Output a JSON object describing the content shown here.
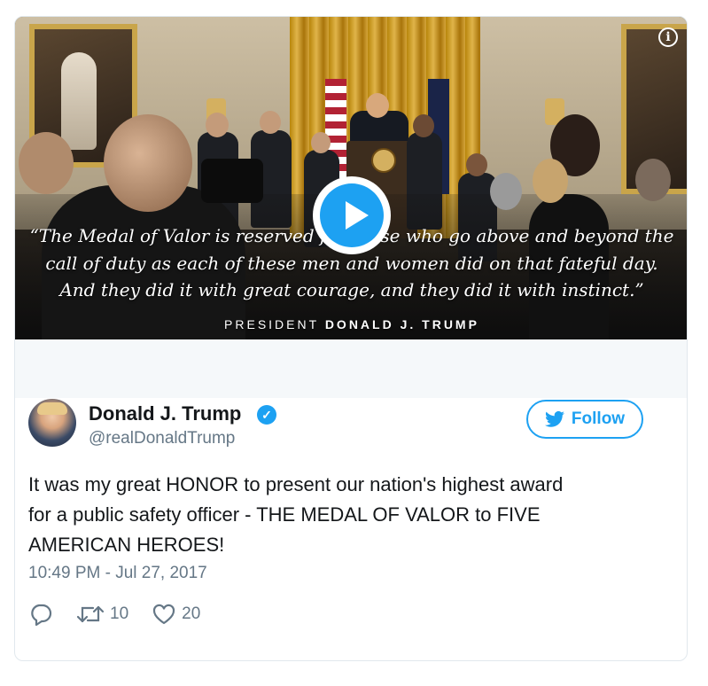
{
  "media": {
    "quote_lines": [
      "“The Medal of Valor is reserved for those who go above and beyond the",
      "call of duty as each of these men and women did on that fateful day.",
      "And they did it with great courage, and they did it with instinct.”"
    ],
    "attribution_prefix": "PRESIDENT",
    "attribution_name": "DONALD J. TRUMP",
    "play_icon": "play-icon",
    "info_icon": "info-icon",
    "info_glyph": "i"
  },
  "author": {
    "name": "Donald J. Trump",
    "handle": "@realDonaldTrump",
    "verified_icon": "verified-badge-icon"
  },
  "follow": {
    "label": "Follow",
    "icon": "twitter-bird-icon"
  },
  "tweet": {
    "text_lines": [
      "It was my great HONOR to present our nation's highest award",
      "for a public safety officer - THE MEDAL OF VALOR to FIVE",
      "AMERICAN HEROES!"
    ],
    "timestamp": "10:49 PM - Jul 27, 2017"
  },
  "actions": {
    "reply_icon": "reply-icon",
    "retweet_icon": "retweet-icon",
    "retweet_count": "10",
    "like_icon": "heart-icon",
    "like_count": "20"
  },
  "colors": {
    "accent": "#1da1f2",
    "text": "#14171a",
    "secondary": "#657786",
    "border": "#e1e8ed",
    "strip": "#f5f8fa"
  }
}
